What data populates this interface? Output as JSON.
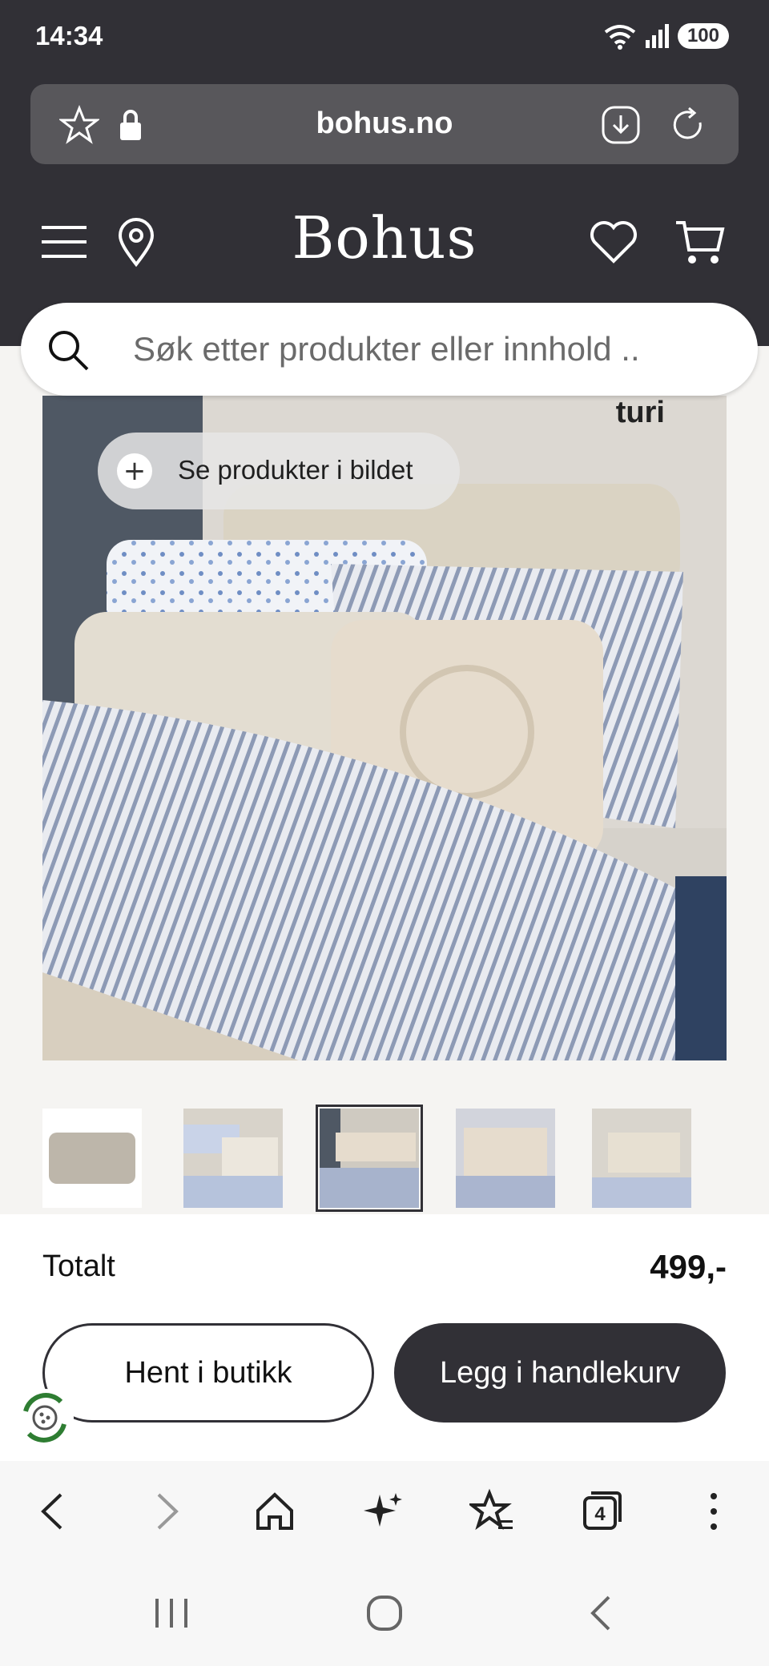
{
  "status_bar": {
    "time": "14:34",
    "battery": "100"
  },
  "browser": {
    "url": "bohus.no"
  },
  "site": {
    "logo": "Bohus"
  },
  "search": {
    "placeholder": "Søk etter produkter eller innhold .."
  },
  "hero": {
    "brand": "turi",
    "see_products_label": "Se produkter i bildet"
  },
  "gallery": {
    "thumbnail_count": 5,
    "selected_index": 2
  },
  "checkout": {
    "total_label": "Totalt",
    "total_value": "499,-",
    "pickup_label": "Hent i butikk",
    "add_to_cart_label": "Legg i handlekurv"
  },
  "browser_toolbar": {
    "tabs_count": "4"
  },
  "colors": {
    "header_bg": "#313036",
    "primary_button": "#313036",
    "page_bg": "#f5f4f2"
  }
}
